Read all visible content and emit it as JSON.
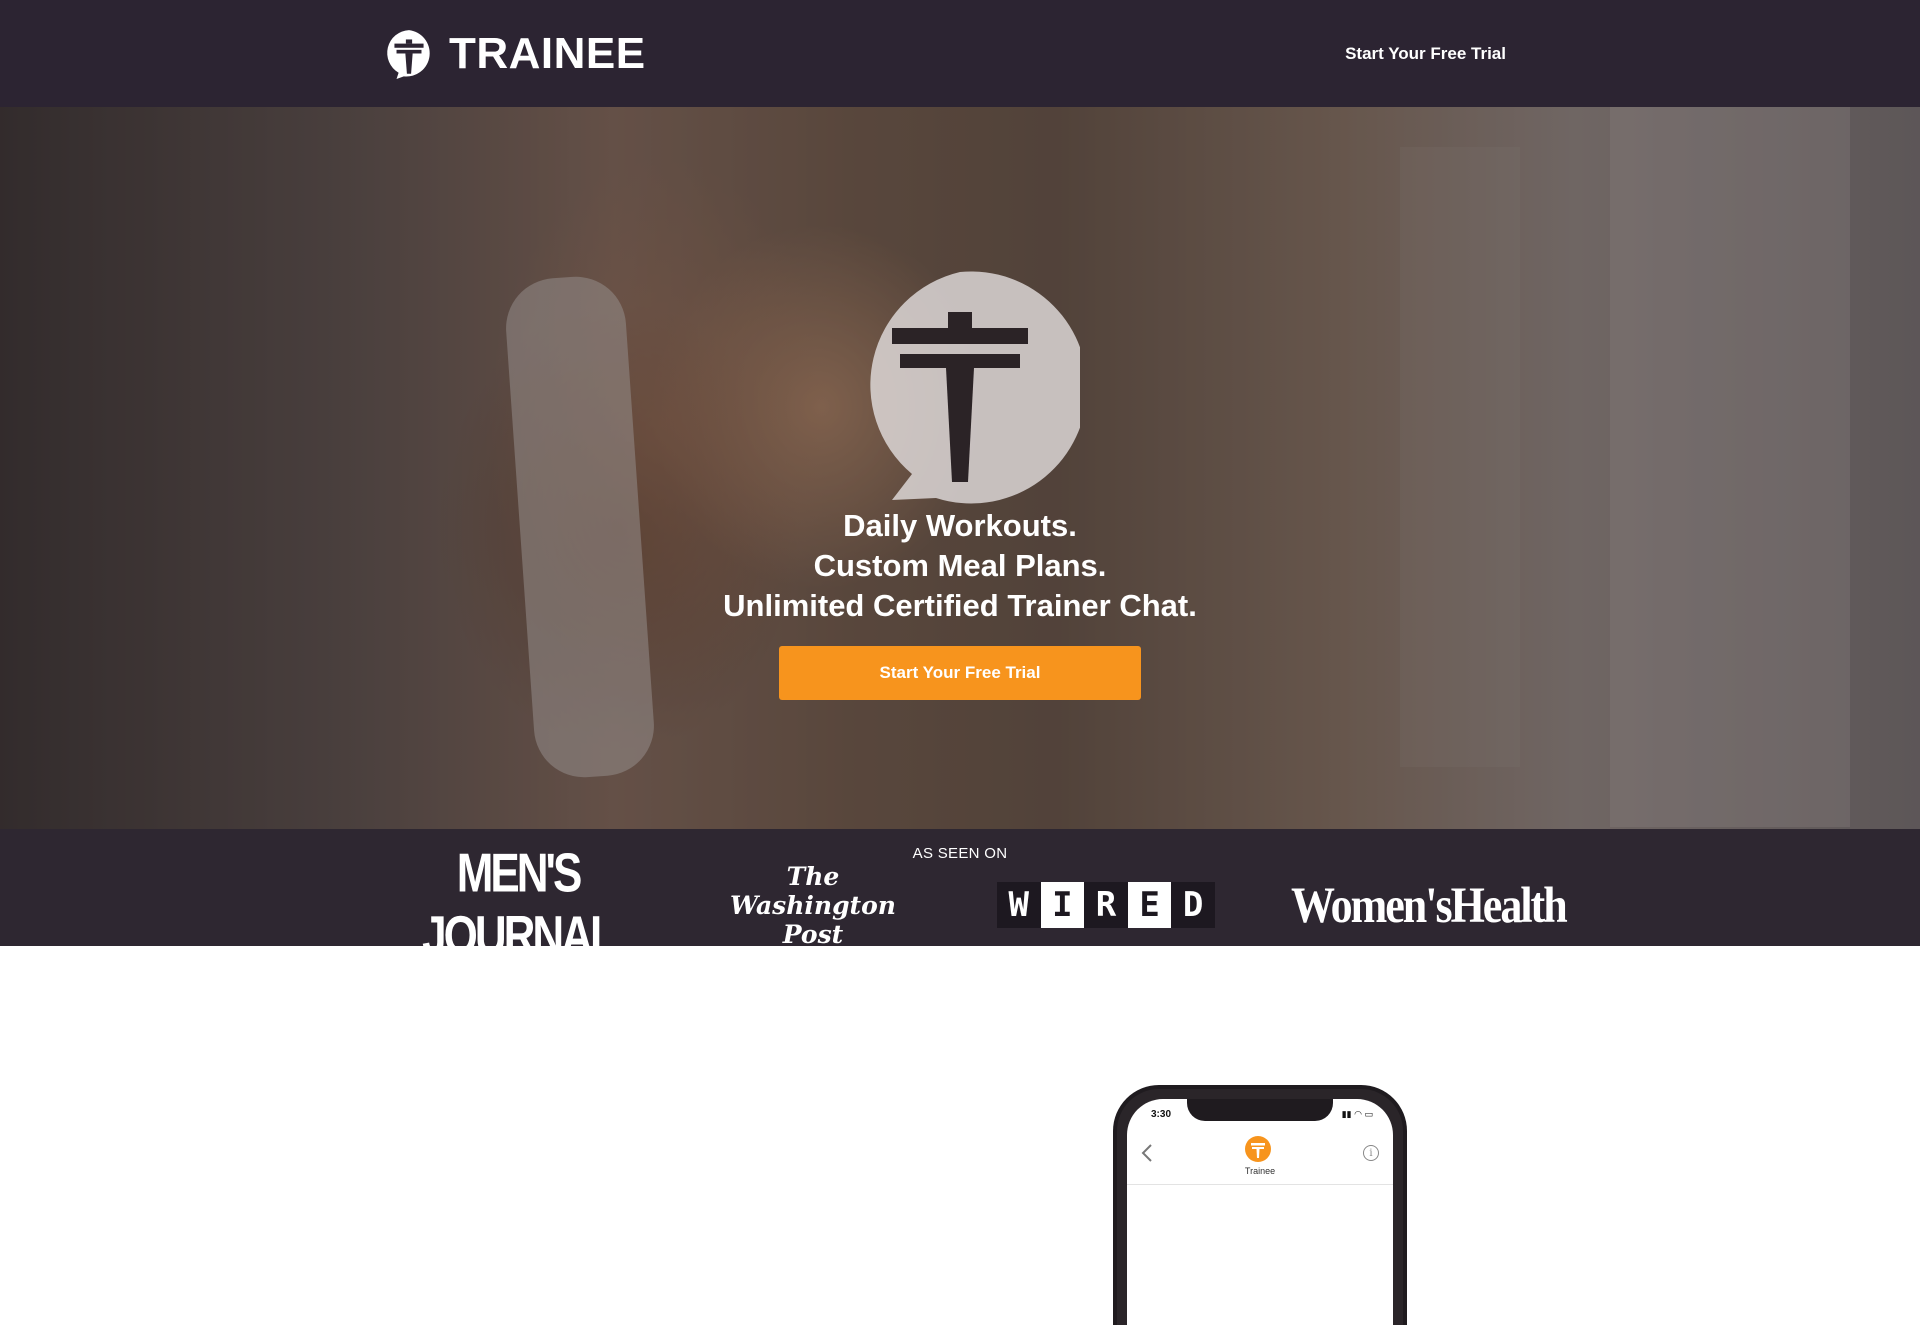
{
  "header": {
    "brand_name": "TRAINEE",
    "cta_label": "Start Your Free Trial"
  },
  "hero": {
    "tagline_lines": [
      "Daily Workouts.",
      "Custom Meal Plans.",
      "Unlimited Certified Trainer Chat."
    ],
    "cta_label": "Start Your Free Trial"
  },
  "press": {
    "label": "AS SEEN ON",
    "logos": [
      "MEN'S JOURNAL",
      "The Washington Post",
      "WIRED",
      "Women'sHealth"
    ]
  },
  "phone": {
    "time": "3:30",
    "app_name": "Trainee"
  },
  "colors": {
    "header_bg": "#2c2432",
    "accent": "#f7941d",
    "press_bg": "#211a24"
  },
  "icons": {
    "brand": "trainee-logo-icon",
    "back": "chevron-left-icon",
    "info": "info-icon"
  }
}
